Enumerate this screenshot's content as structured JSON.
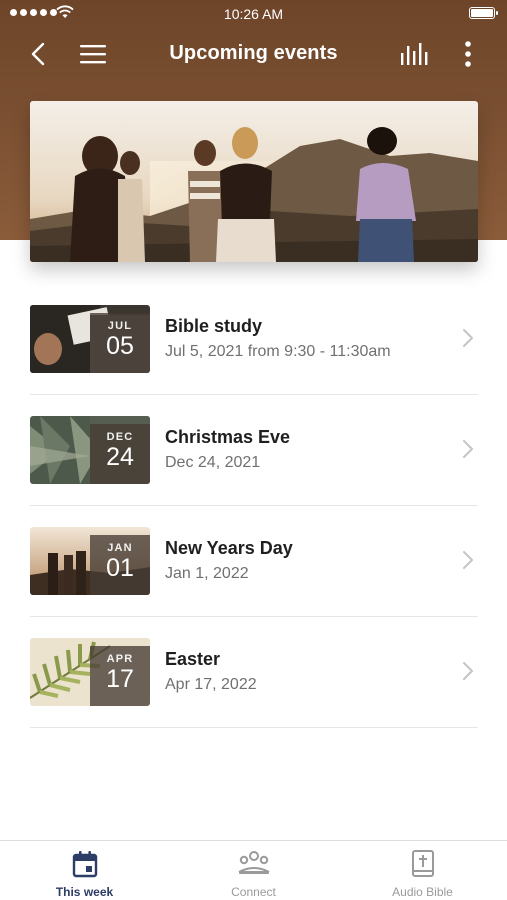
{
  "status_bar": {
    "time": "10:26 AM"
  },
  "nav": {
    "title": "Upcoming events"
  },
  "events": [
    {
      "title": "Bible study",
      "subtitle": "Jul 5, 2021 from 9:30 - 11:30am",
      "month": "JUL",
      "day": "05"
    },
    {
      "title": "Christmas Eve",
      "subtitle": "Dec 24, 2021",
      "month": "DEC",
      "day": "24"
    },
    {
      "title": "New Years Day",
      "subtitle": "Jan 1, 2022",
      "month": "JAN",
      "day": "01"
    },
    {
      "title": "Easter",
      "subtitle": "Apr 17, 2022",
      "month": "APR",
      "day": "17"
    }
  ],
  "tabs": [
    {
      "label": "This week",
      "icon": "calendar-icon",
      "active": true
    },
    {
      "label": "Connect",
      "icon": "people-icon",
      "active": false
    },
    {
      "label": "Audio Bible",
      "icon": "bible-icon",
      "active": false
    }
  ],
  "colors": {
    "header": "#7a4f31",
    "active_tab": "#2c3e66",
    "inactive_tab": "#9a9a9a"
  }
}
